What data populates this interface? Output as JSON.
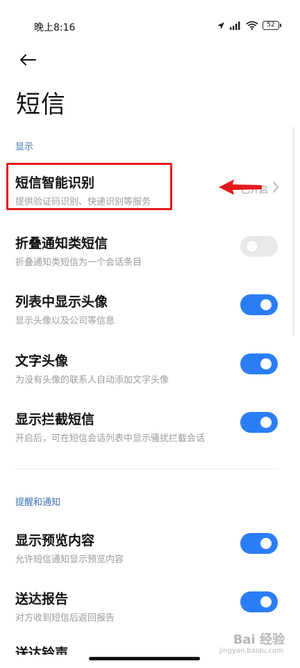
{
  "status_bar": {
    "time": "晚上8:16",
    "battery": "52"
  },
  "page": {
    "title": "短信"
  },
  "sections": [
    {
      "header": "显示"
    },
    {
      "header": "提醒和通知"
    }
  ],
  "rows": [
    {
      "title": "短信智能识别",
      "subtitle": "提供验证码识别、快递识别等服务",
      "value": "已开启",
      "control": "chevron"
    },
    {
      "title": "折叠通知类短信",
      "subtitle": "折叠通知类短信为一个会话条目",
      "control": "toggle",
      "on": false
    },
    {
      "title": "列表中显示头像",
      "subtitle": "显示头像以及公司等信息",
      "control": "toggle",
      "on": true
    },
    {
      "title": "文字头像",
      "subtitle": "为没有头像的联系人自动添加文字头像",
      "control": "toggle",
      "on": true
    },
    {
      "title": "显示拦截短信",
      "subtitle": "开启后，可在短信会话列表中显示骚扰拦截会话",
      "control": "toggle",
      "on": true
    },
    {
      "title": "显示预览内容",
      "subtitle": "允许短信通知显示预览内容",
      "control": "toggle",
      "on": true
    },
    {
      "title": "送达报告",
      "subtitle": "对方收到短信后返回报告",
      "control": "toggle",
      "on": true
    },
    {
      "title": "送达铃声"
    }
  ],
  "watermark": {
    "brand": "Bai 经验",
    "url": "jingyan.baidu.com"
  },
  "colors": {
    "accent": "#2a7df5",
    "section_header": "#3b6fb0",
    "annotation": "#e31b1b"
  },
  "icons": [
    "location-icon",
    "signal-icon",
    "wifi-icon",
    "battery-icon",
    "back-arrow-icon",
    "chevron-right-icon",
    "red-arrow-annotation"
  ]
}
